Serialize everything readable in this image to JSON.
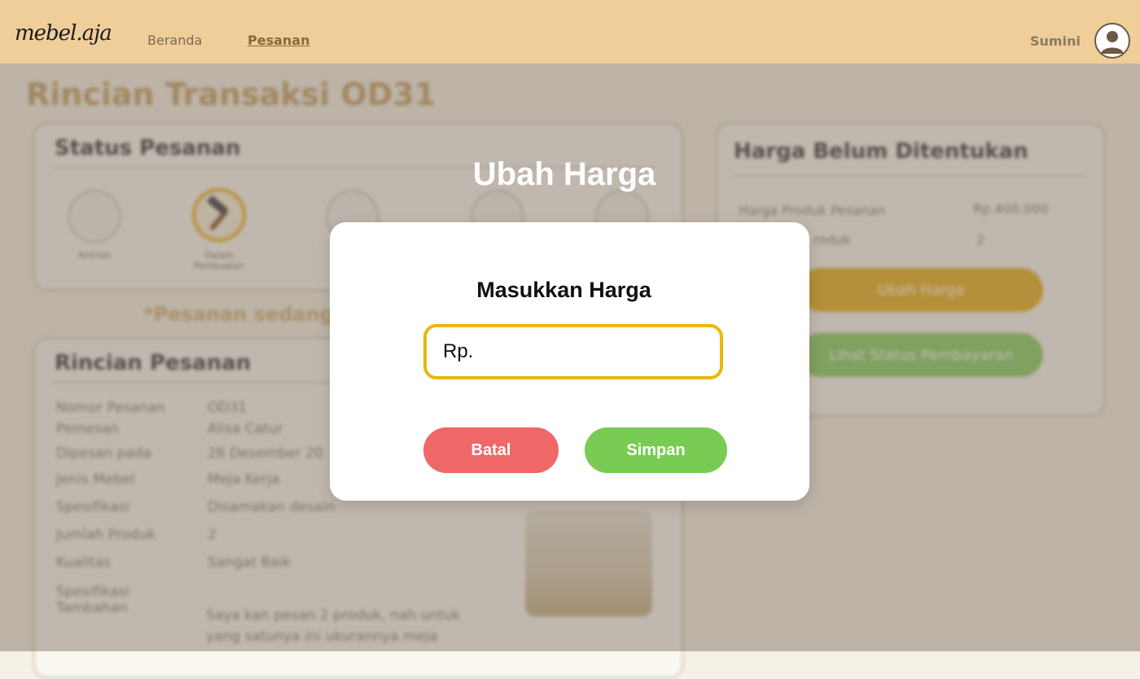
{
  "navbar": {
    "logo": "mebel.aja",
    "links": [
      {
        "label": "Beranda",
        "active": false
      },
      {
        "label": "Pesanan",
        "active": true
      }
    ],
    "user_name": "Sumini"
  },
  "page": {
    "title": "Rincian Transaksi OD31",
    "status_card": {
      "heading": "Status Pesanan",
      "steps": [
        {
          "label": "Antrian",
          "icon": "queue-icon"
        },
        {
          "label": "Dalam Pembuatan",
          "icon": "hammer-icon",
          "active": true
        },
        {
          "label": "",
          "icon": "box-icon"
        },
        {
          "label": "",
          "icon": "truck-icon"
        },
        {
          "label": "",
          "icon": "done-icon"
        }
      ]
    },
    "notice": "*Pesanan sedang",
    "detail_card": {
      "heading": "Rincian Pesanan",
      "rows": [
        {
          "label": "Nomor Pesanan",
          "value": "OD31"
        },
        {
          "label": "Pemesan",
          "value": "Alisa Catur"
        },
        {
          "label": "Dipesan pada",
          "value": "26 Desember 20"
        },
        {
          "label": "Jenis Mebel",
          "value": "Meja Kerja"
        },
        {
          "label": "Spesifikasi",
          "value": "Disamakan desain"
        },
        {
          "label": "Jumlah Produk",
          "value": "2"
        },
        {
          "label": "Kualitas",
          "value": "Sangat Baik"
        },
        {
          "label": "Spesifikasi Tambahan",
          "value": "Saya kan pesan 2 produk, nah untuk yang satunya ini ukurannya meja"
        }
      ]
    },
    "price_card": {
      "heading": "Harga Belum Ditentukan",
      "rows": [
        {
          "label": "Harga Produk Pesanan",
          "value": "Rp.400.000"
        },
        {
          "label": "roduk",
          "value": "2"
        }
      ],
      "change_price_button": "Ubah Harga",
      "payment_status_button": "Lihat Status Pembayaran"
    }
  },
  "modal": {
    "heading": "Ubah Harga",
    "title": "Masukkan Harga",
    "input_value": "Rp.",
    "cancel_label": "Batal",
    "save_label": "Simpan"
  },
  "colors": {
    "navbar_bg": "#efce9a",
    "accent_yellow": "#e9b70e",
    "cancel_red": "#f06767",
    "save_green": "#78cc53"
  }
}
